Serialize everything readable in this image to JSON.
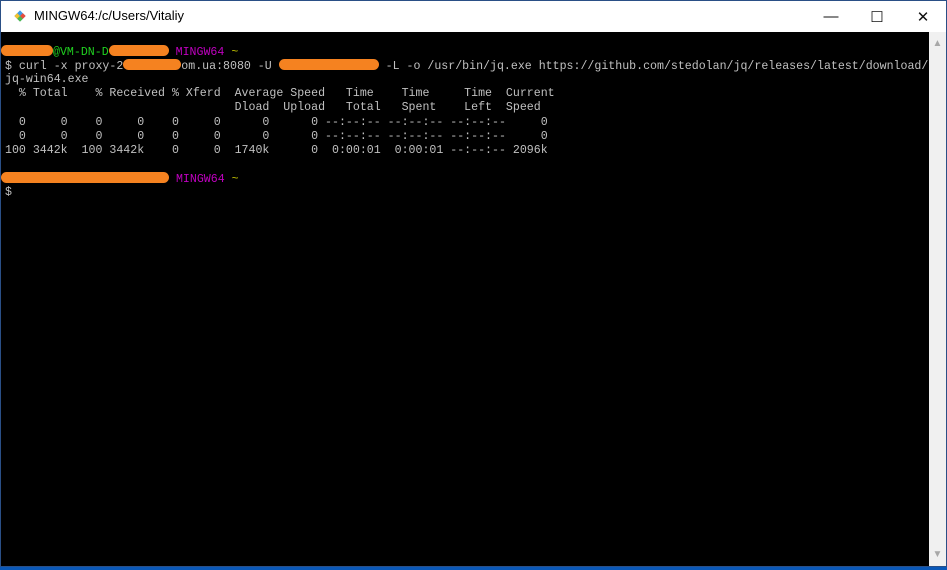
{
  "window": {
    "title": "MINGW64:/c/Users/Vitaliy",
    "minimize": "—",
    "maximize": "☐",
    "close": "✕"
  },
  "terminal": {
    "prompt1": {
      "at_host": "@VM-DN-D",
      "shell": "MINGW64",
      "path": "~"
    },
    "cmd": {
      "p1": "$ curl -x proxy-2",
      "p2": "om.ua:8080 -U ",
      "p3": " -L -o /usr/bin/jq.exe https://github.com/stedolan/jq/releases/latest/download/",
      "wrap": "jq-win64.exe"
    },
    "header1": "  % Total    % Received % Xferd  Average Speed   Time    Time     Time  Current",
    "header2": "                                 Dload  Upload   Total   Spent    Left  Speed",
    "rows": [
      "  0     0    0     0    0     0      0      0 --:--:-- --:--:-- --:--:--     0",
      "  0     0    0     0    0     0      0      0 --:--:-- --:--:-- --:--:--     0",
      "100 3442k  100 3442k    0     0  1740k      0  0:00:01  0:00:01 --:--:-- 2096k"
    ],
    "prompt2": {
      "shell": "MINGW64",
      "path": "~"
    },
    "cursor_prompt": "$"
  },
  "colors": {
    "redaction": "#f58220",
    "user_host": "#20d020",
    "shell": "#c000c0",
    "path": "#b8b800"
  }
}
